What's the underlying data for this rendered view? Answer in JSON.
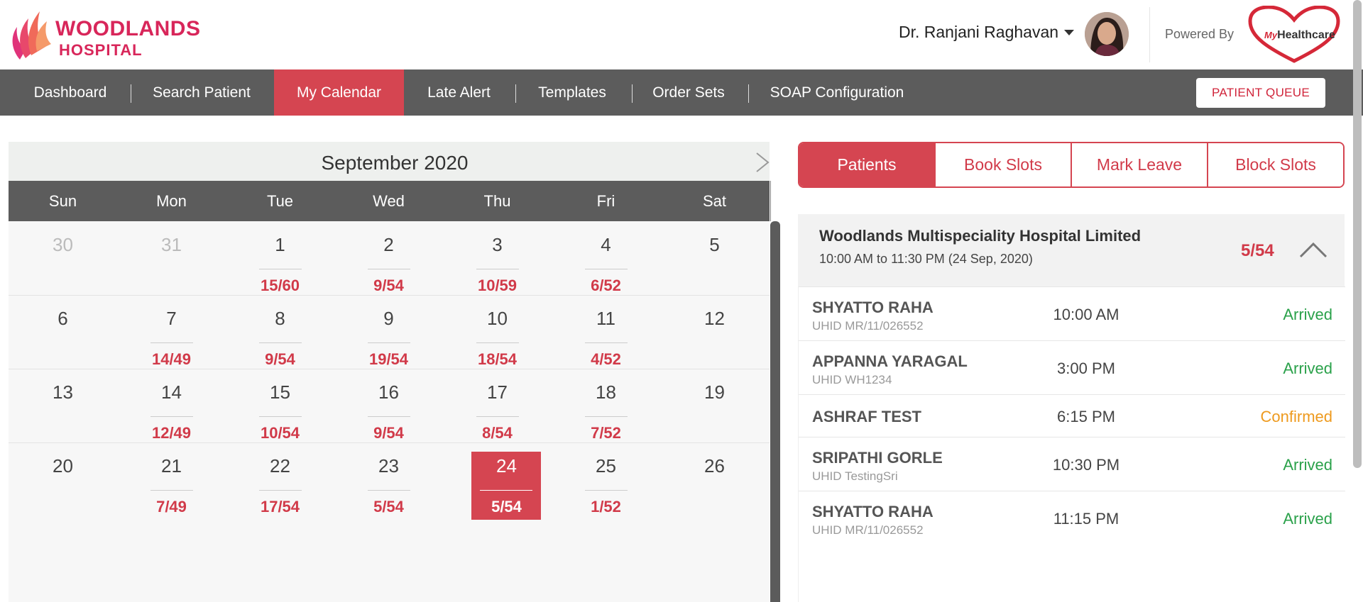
{
  "header": {
    "brand_line1": "WOODLANDS",
    "brand_line2": "HOSPITAL",
    "doctor_name": "Dr. Ranjani Raghavan",
    "powered_by": "Powered By",
    "partner_logo_prefix": "My",
    "partner_logo_text": "Healthcare"
  },
  "nav": {
    "items": [
      {
        "label": "Dashboard"
      },
      {
        "label": "Search Patient"
      },
      {
        "label": "My Calendar",
        "active": true
      },
      {
        "label": "Late Alert"
      },
      {
        "label": "Templates"
      },
      {
        "label": "Order Sets"
      },
      {
        "label": "SOAP Configuration"
      }
    ],
    "queue_button": "PATIENT QUEUE"
  },
  "calendar": {
    "month": "September 2020",
    "weekdays": [
      "Sun",
      "Mon",
      "Tue",
      "Wed",
      "Thu",
      "Fri",
      "Sat"
    ],
    "weeks": [
      [
        {
          "d": "30",
          "muted": true
        },
        {
          "d": "31",
          "muted": true
        },
        {
          "d": "1",
          "c": "15/60"
        },
        {
          "d": "2",
          "c": "9/54"
        },
        {
          "d": "3",
          "c": "10/59"
        },
        {
          "d": "4",
          "c": "6/52"
        },
        {
          "d": "5"
        }
      ],
      [
        {
          "d": "6"
        },
        {
          "d": "7",
          "c": "14/49"
        },
        {
          "d": "8",
          "c": "9/54"
        },
        {
          "d": "9",
          "c": "19/54"
        },
        {
          "d": "10",
          "c": "18/54"
        },
        {
          "d": "11",
          "c": "4/52"
        },
        {
          "d": "12"
        }
      ],
      [
        {
          "d": "13"
        },
        {
          "d": "14",
          "c": "12/49"
        },
        {
          "d": "15",
          "c": "10/54"
        },
        {
          "d": "16",
          "c": "9/54"
        },
        {
          "d": "17",
          "c": "8/54"
        },
        {
          "d": "18",
          "c": "7/52"
        },
        {
          "d": "19"
        }
      ],
      [
        {
          "d": "20"
        },
        {
          "d": "21",
          "c": "7/49"
        },
        {
          "d": "22",
          "c": "17/54"
        },
        {
          "d": "23",
          "c": "5/54"
        },
        {
          "d": "24",
          "c": "5/54",
          "selected": true
        },
        {
          "d": "25",
          "c": "1/52"
        },
        {
          "d": "26"
        }
      ]
    ]
  },
  "tabs": [
    {
      "label": "Patients",
      "active": true
    },
    {
      "label": "Book Slots"
    },
    {
      "label": "Mark Leave"
    },
    {
      "label": "Block Slots"
    }
  ],
  "hospital": {
    "name": "Woodlands Multispeciality Hospital Limited",
    "time": "10:00 AM to 11:30 PM (24 Sep, 2020)",
    "count": "5/54"
  },
  "patients": [
    {
      "name": "SHYATTO RAHA",
      "uhid": "UHID MR/11/026552",
      "time": "10:00 AM",
      "status": "Arrived"
    },
    {
      "name": "APPANNA YARAGAL",
      "uhid": "UHID WH1234",
      "time": "3:00 PM",
      "status": "Arrived"
    },
    {
      "name": "ASHRAF TEST",
      "uhid": "",
      "time": "6:15 PM",
      "status": "Confirmed"
    },
    {
      "name": "SRIPATHI GORLE",
      "uhid": "UHID TestingSri",
      "time": "10:30 PM",
      "status": "Arrived"
    },
    {
      "name": "SHYATTO RAHA",
      "uhid": "UHID MR/11/026552",
      "time": "11:15 PM",
      "status": "Arrived"
    }
  ],
  "colors": {
    "brand": "#d8265a",
    "accent": "#d54551",
    "nav_bg": "#5c5c5c",
    "arrived": "#2aa14a",
    "confirmed": "#ee9a1e"
  }
}
